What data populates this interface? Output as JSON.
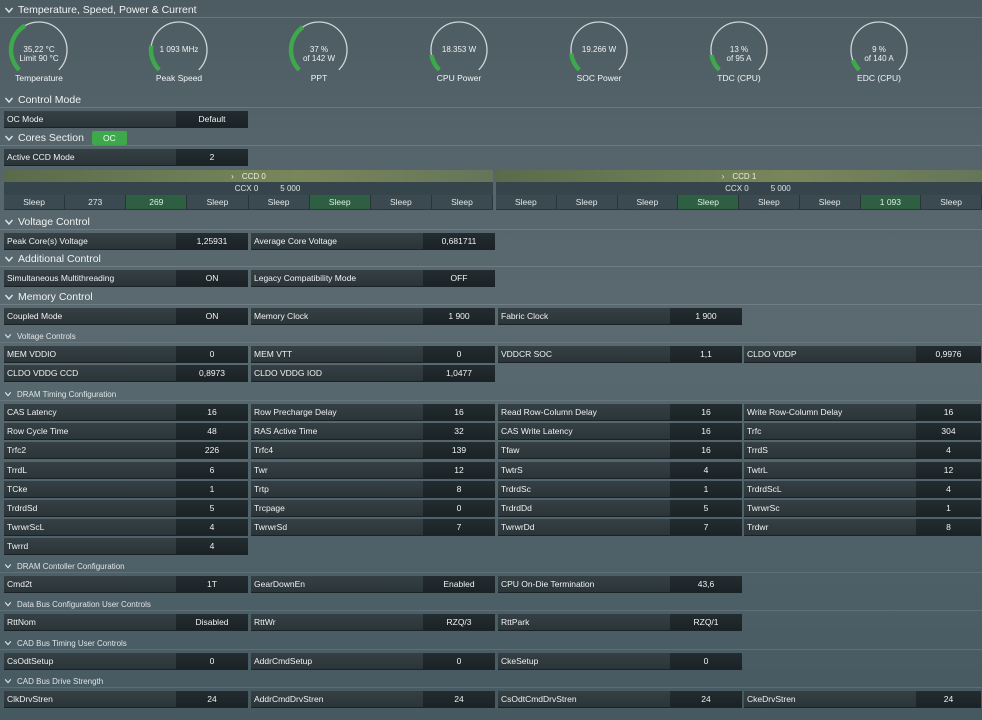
{
  "sections": {
    "temp": "Temperature, Speed, Power & Current",
    "control": "Control Mode",
    "cores": "Cores Section",
    "voltage": "Voltage Control",
    "additional": "Additional Control",
    "memory": "Memory Control"
  },
  "subsections": {
    "vc": "Voltage Controls",
    "dram": "DRAM Timing Configuration",
    "dcc": "DRAM Contoller Configuration",
    "dbus": "Data Bus Configuration User Controls",
    "cad": "CAD Bus Timing User Controls",
    "cadd": "CAD Bus Drive Strength"
  },
  "cores_badge": "OC",
  "gauges": [
    {
      "l1": "35,22 °C",
      "l2": "Limit 90 °C",
      "label": "Temperature",
      "pct": 0.39
    },
    {
      "l1": "1 093  MHz",
      "l2": "",
      "label": "Peak Speed",
      "pct": 0.2
    },
    {
      "l1": "37 %",
      "l2": "of 142 W",
      "label": "PPT",
      "pct": 0.37
    },
    {
      "l1": "18.353 W",
      "l2": "",
      "label": "CPU Power",
      "pct": 0.13
    },
    {
      "l1": "19.266 W",
      "l2": "",
      "label": "SOC Power",
      "pct": 0.14
    },
    {
      "l1": "13 %",
      "l2": "of 95 A",
      "label": "TDC (CPU)",
      "pct": 0.13
    },
    {
      "l1": "9 %",
      "l2": "of 140 A",
      "label": "EDC (CPU)",
      "pct": 0.09
    }
  ],
  "ocmode": {
    "l": "OC Mode",
    "v": "Default"
  },
  "activeccd": {
    "l": "Active CCD Mode",
    "v": "2"
  },
  "ccd": [
    {
      "name": "CCD 0",
      "ccx": "CCX 0",
      "freq": "5 000",
      "cores": [
        "Sleep",
        "273",
        "269",
        "Sleep",
        "Sleep",
        "Sleep",
        "Sleep",
        "Sleep"
      ],
      "active": [
        2,
        5
      ]
    },
    {
      "name": "CCD 1",
      "ccx": "CCX 0",
      "freq": "5 000",
      "cores": [
        "Sleep",
        "Sleep",
        "Sleep",
        "Sleep",
        "Sleep",
        "Sleep",
        "1 093",
        "Sleep"
      ],
      "active": [
        3,
        6
      ]
    }
  ],
  "voltage": [
    {
      "l": "Peak Core(s) Voltage",
      "v": "1,25931"
    },
    {
      "l": "Average Core Voltage",
      "v": "0,681711"
    }
  ],
  "additional": [
    {
      "l": "Simultaneous Multithreading",
      "v": "ON"
    },
    {
      "l": "Legacy Compatibility Mode",
      "v": "OFF"
    }
  ],
  "memory": [
    {
      "l": "Coupled Mode",
      "v": "ON"
    },
    {
      "l": "Memory Clock",
      "v": "1 900"
    },
    {
      "l": "Fabric Clock",
      "v": "1 900"
    }
  ],
  "vc": [
    [
      {
        "l": "MEM VDDIO",
        "v": "0"
      },
      {
        "l": "MEM VTT",
        "v": "0"
      },
      {
        "l": "VDDCR SOC",
        "v": "1,1"
      },
      {
        "l": "CLDO VDDP",
        "v": "0,9976"
      }
    ],
    [
      {
        "l": "CLDO VDDG CCD",
        "v": "0,8973"
      },
      {
        "l": "CLDO VDDG IOD",
        "v": "1,0477"
      }
    ]
  ],
  "dram": [
    [
      {
        "l": "CAS Latency",
        "v": "16"
      },
      {
        "l": "Row Precharge Delay",
        "v": "16"
      },
      {
        "l": "Read Row-Column Delay",
        "v": "16"
      },
      {
        "l": "Write Row-Column Delay",
        "v": "16"
      }
    ],
    [
      {
        "l": "Row Cycle Time",
        "v": "48"
      },
      {
        "l": "RAS Active Time",
        "v": "32"
      },
      {
        "l": "CAS Write Latency",
        "v": "16"
      },
      {
        "l": "Trfc",
        "v": "304"
      }
    ],
    [
      {
        "l": "Trfc2",
        "v": "226"
      },
      {
        "l": "Trfc4",
        "v": "139"
      },
      {
        "l": "Tfaw",
        "v": "16"
      },
      {
        "l": "TrrdS",
        "v": "4"
      }
    ],
    [
      {
        "l": "TrrdL",
        "v": "6"
      },
      {
        "l": "Twr",
        "v": "12"
      },
      {
        "l": "TwtrS",
        "v": "4"
      },
      {
        "l": "TwtrL",
        "v": "12"
      }
    ],
    [
      {
        "l": "TCke",
        "v": "1"
      },
      {
        "l": "Trtp",
        "v": "8"
      },
      {
        "l": "TrdrdSc",
        "v": "1"
      },
      {
        "l": "TrdrdScL",
        "v": "4"
      }
    ],
    [
      {
        "l": "TrdrdSd",
        "v": "5"
      },
      {
        "l": "Trcpage",
        "v": "0"
      },
      {
        "l": "TrdrdDd",
        "v": "5"
      },
      {
        "l": "TwrwrSc",
        "v": "1"
      }
    ],
    [
      {
        "l": "TwrwrScL",
        "v": "4"
      },
      {
        "l": "TwrwrSd",
        "v": "7"
      },
      {
        "l": "TwrwrDd",
        "v": "7"
      },
      {
        "l": "Trdwr",
        "v": "8"
      }
    ],
    [
      {
        "l": "Twrrd",
        "v": "4"
      }
    ]
  ],
  "dcc": [
    {
      "l": "Cmd2t",
      "v": "1T"
    },
    {
      "l": "GearDownEn",
      "v": "Enabled"
    },
    {
      "l": "CPU On-Die Termination",
      "v": "43,6"
    }
  ],
  "dbus": [
    {
      "l": "RttNom",
      "v": "Disabled"
    },
    {
      "l": "RttWr",
      "v": "RZQ/3"
    },
    {
      "l": "RttPark",
      "v": "RZQ/1"
    }
  ],
  "cad": [
    {
      "l": "CsOdtSetup",
      "v": "0"
    },
    {
      "l": "AddrCmdSetup",
      "v": "0"
    },
    {
      "l": "CkeSetup",
      "v": "0"
    }
  ],
  "cadd": [
    {
      "l": "ClkDrvStren",
      "v": "24"
    },
    {
      "l": "AddrCmdDrvStren",
      "v": "24"
    },
    {
      "l": "CsOdtCmdDrvStren",
      "v": "24"
    },
    {
      "l": "CkeDrvStren",
      "v": "24"
    }
  ],
  "colors": {
    "accent": "#3da84c",
    "gauge_track": "#cfd6d8"
  }
}
